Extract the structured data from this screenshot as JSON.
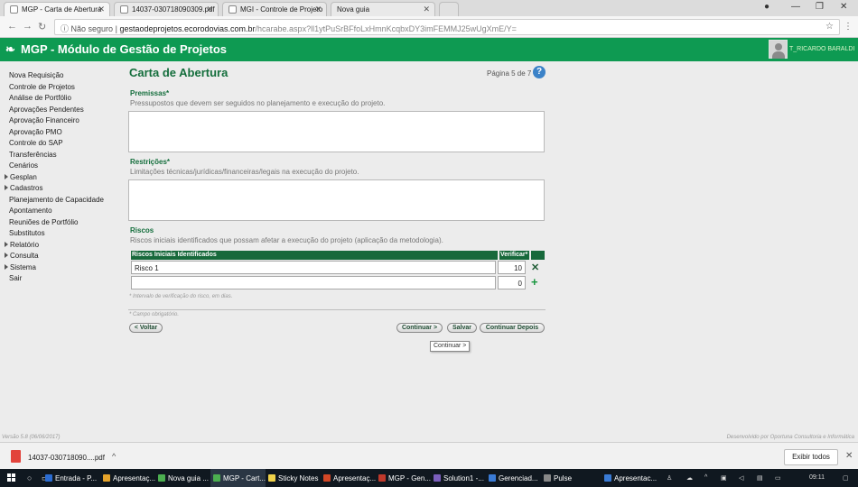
{
  "browser": {
    "tabs": [
      {
        "label": "MGP - Carta de Abertura",
        "active": true
      },
      {
        "label": "14037-030718090309.pdf",
        "active": false
      },
      {
        "label": "MGI - Controle de Projeto",
        "active": false
      },
      {
        "label": "Nova guia",
        "active": false
      }
    ],
    "security_label": "Não seguro",
    "url_host": "gestaodeprojetos.ecorodovias.com.br",
    "url_path": "/hcarabe.aspx?ll1ytPuSrBFfoLxHmnKcqbxDY3imFEMMJ25wUgXmE/Y="
  },
  "header": {
    "logo_icon": "leaf-icon",
    "title": "MGP - Módulo de Gestão de Projetos",
    "user": "T_RICARDO BARALDI",
    "brand_color": "#0e9a52"
  },
  "sidebar": {
    "items": [
      {
        "label": "Nova Requisição",
        "submenu": false
      },
      {
        "label": "Controle de Projetos",
        "submenu": false
      },
      {
        "label": "Análise de Portfólio",
        "submenu": false
      },
      {
        "label": "Aprovações Pendentes",
        "submenu": false
      },
      {
        "label": "Aprovação Financeiro",
        "submenu": false
      },
      {
        "label": "Aprovação PMO",
        "submenu": false
      },
      {
        "label": "Controle do SAP",
        "submenu": false
      },
      {
        "label": "Transferências",
        "submenu": false
      },
      {
        "label": "Cenários",
        "submenu": false
      },
      {
        "label": "Gesplan",
        "submenu": true
      },
      {
        "label": "Cadastros",
        "submenu": true
      },
      {
        "label": "Planejamento de Capacidade",
        "submenu": false
      },
      {
        "label": "Apontamento",
        "submenu": false
      },
      {
        "label": "Reuniões de Portfólio",
        "submenu": false
      },
      {
        "label": "Substitutos",
        "submenu": false
      },
      {
        "label": "Relatório",
        "submenu": true
      },
      {
        "label": "Consulta",
        "submenu": true
      },
      {
        "label": "Sistema",
        "submenu": true
      },
      {
        "label": "Sair",
        "submenu": false
      }
    ]
  },
  "page": {
    "title": "Carta de Abertura",
    "page_indicator": "Página 5 de 7",
    "help_label": "?",
    "premissas": {
      "label": "Premissas*",
      "description": "Pressupostos que devem ser seguidos no planejamento e execução do projeto.",
      "value": ""
    },
    "restricoes": {
      "label": "Restrições*",
      "description": "Limitações técnicas/jurídicas/financeiras/legais na execução do projeto.",
      "value": ""
    },
    "riscos": {
      "label": "Riscos",
      "description": "Riscos iniciais identificados que possam afetar a execução do projeto (aplicação da metodologia).",
      "col_risk": "Riscos Iniciais Identificados",
      "col_verify": "Verificar*",
      "rows": [
        {
          "risk": "Risco 1",
          "verify": "10",
          "action": "x"
        },
        {
          "risk": "",
          "verify": "0",
          "action": "+"
        }
      ],
      "note": "* Intervalo de verificação do risco, em dias."
    },
    "required_note": "* Campo obrigatório.",
    "buttons": {
      "back": "< Voltar",
      "continue": "Continuar >",
      "save": "Salvar",
      "continue_later": "Continuar Depois"
    },
    "tooltip": "Continuar >"
  },
  "footer": {
    "version": "Versão 5.8 (06/06/2017)",
    "developer": "Desenvolvido por Oportuna Consultoria e Informática"
  },
  "downloads": {
    "file": "14037-030718090....pdf",
    "show_all": "Exibir todos"
  },
  "taskbar": {
    "tasks": [
      {
        "label": "Entrada - P...",
        "color": "#2b6cd1"
      },
      {
        "label": "Apresentaç...",
        "color": "#e5a32b"
      },
      {
        "label": "Nova guia ...",
        "color": "#4caf50"
      },
      {
        "label": "MGP - Cart...",
        "color": "#4caf50"
      },
      {
        "label": "Sticky Notes",
        "color": "#f0d24a"
      },
      {
        "label": "Apresentaç...",
        "color": "#d24726"
      },
      {
        "label": "MGP - Gen...",
        "color": "#c0392b"
      },
      {
        "label": "Solution1 -...",
        "color": "#7b5fbd"
      },
      {
        "label": "Gerenciad...",
        "color": "#3a7bd5"
      },
      {
        "label": "Pulse",
        "color": "#888888"
      },
      {
        "label": "Apresentac...",
        "color": "#3a7bd5"
      }
    ],
    "time": "09:11"
  }
}
